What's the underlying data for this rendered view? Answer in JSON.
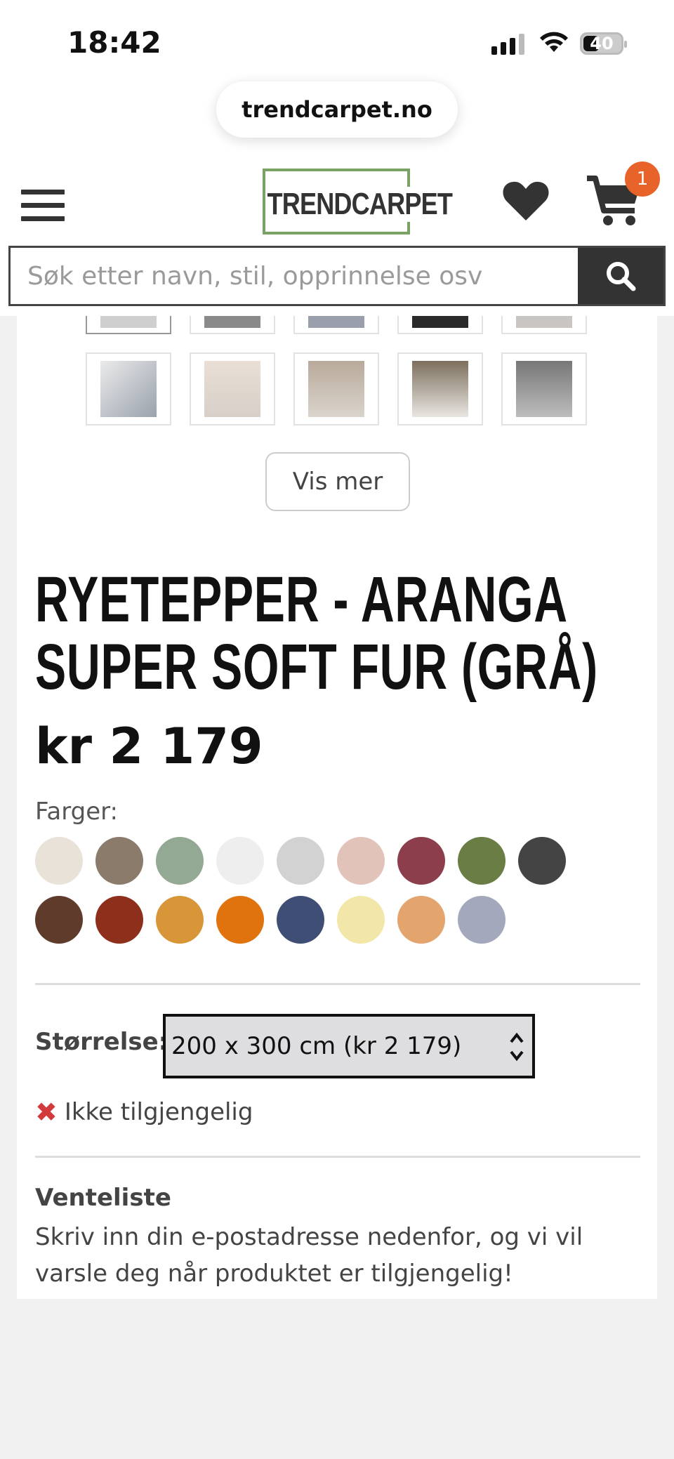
{
  "status": {
    "time": "18:42",
    "battery": "40"
  },
  "browser": {
    "url": "trendcarpet.no"
  },
  "header": {
    "logo": "TRENDCARPET",
    "cart_count": "1",
    "search_placeholder": "Søk etter navn, stil, opprinnelse osv"
  },
  "gallery": {
    "show_more": "Vis mer"
  },
  "product": {
    "title": "RYETEPPER - ARANGA SUPER SOFT FUR (GRÅ)",
    "price": "kr 2 179",
    "colors_label": "Farger:",
    "colors": [
      "#e9e2d9",
      "#8b7b6b",
      "#93a994",
      "#eeeeee",
      "#d2d2d2",
      "#e2c3b9",
      "#8c3e4d",
      "#6a7d45",
      "#444444",
      "#5e3b2b",
      "#8e2f1c",
      "#d89638",
      "#e0730d",
      "#3e4e74",
      "#f2e7a8",
      "#e3a46d",
      "#a3a8bd"
    ],
    "size_label": "Størrelse:",
    "size_value": "200 x 300 cm (kr 2 179)",
    "availability": "Ikke tilgjengelig",
    "waitlist_title": "Venteliste",
    "waitlist_text": "Skriv inn din e-postadresse nedenfor, og vi vil varsle deg når produktet er tilgjengelig!"
  }
}
